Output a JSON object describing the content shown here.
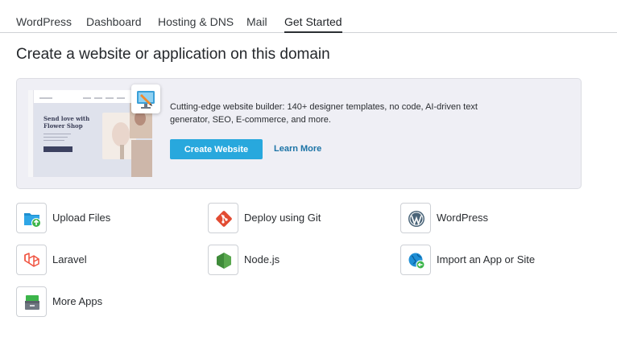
{
  "tabs": [
    {
      "label": "WordPress"
    },
    {
      "label": "Dashboard"
    },
    {
      "label": "Hosting & DNS"
    },
    {
      "label": "Mail"
    },
    {
      "label": "Get Started",
      "active": true
    }
  ],
  "page_title": "Create a website or application on this domain",
  "promo": {
    "preview_heading_line1": "Send love with",
    "preview_heading_line2": "Flower Shop",
    "description": "Cutting-edge website builder: 140+ designer templates, no code, AI-driven text generator, SEO, E-commerce, and more.",
    "primary_button": "Create Website",
    "secondary_link": "Learn More",
    "icon": "site-builder-icon"
  },
  "apps": [
    {
      "label": "Upload Files",
      "icon": "upload-folder-icon"
    },
    {
      "label": "Deploy using Git",
      "icon": "git-icon"
    },
    {
      "label": "WordPress",
      "icon": "wordpress-icon"
    },
    {
      "label": "Laravel",
      "icon": "laravel-icon"
    },
    {
      "label": "Node.js",
      "icon": "nodejs-icon"
    },
    {
      "label": "Import an App or Site",
      "icon": "import-globe-icon"
    },
    {
      "label": "More Apps",
      "icon": "apps-catalog-icon"
    }
  ],
  "colors": {
    "accent": "#28a8dd",
    "link": "#1b73a6",
    "promo_background": "#efeff5"
  }
}
